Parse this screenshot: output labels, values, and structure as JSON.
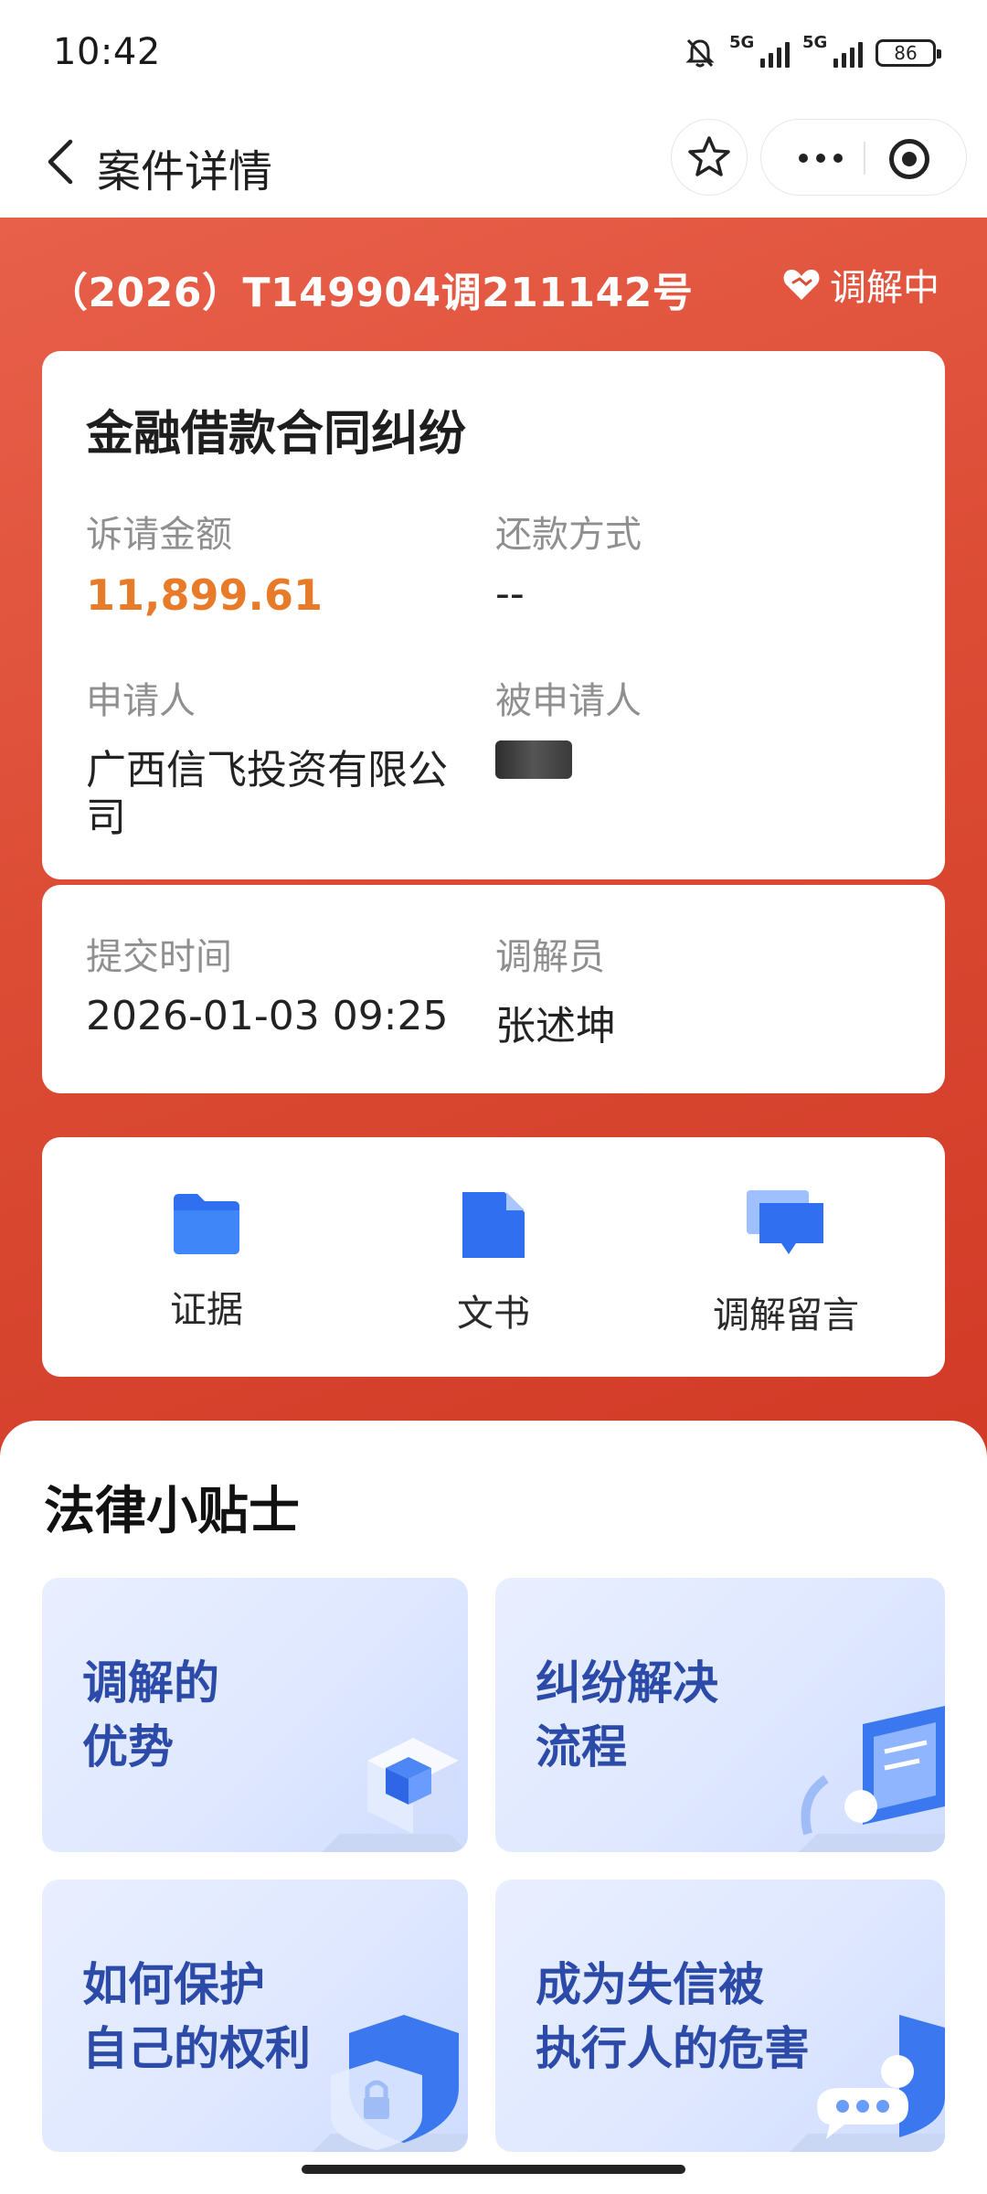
{
  "status_bar": {
    "time": "10:42",
    "network_1": "5G",
    "network_2": "5G",
    "battery": "86"
  },
  "nav": {
    "title": "案件详情",
    "back_icon": "chevron-left-icon",
    "favorite_icon": "star-icon",
    "more_icon": "more-dots-icon",
    "close_icon": "target-icon"
  },
  "case": {
    "number": "（2026）T149904调211142号",
    "status": "调解中",
    "status_icon": "heart-handshake-icon",
    "title": "金融借款合同纠纷",
    "claim_amount_label": "诉请金额",
    "claim_amount": "11,899.61",
    "repayment_label": "还款方式",
    "repayment": "--",
    "applicant_label": "申请人",
    "applicant_line1": "广西信飞投资有限公",
    "applicant_line2": "司",
    "respondent_label": "被申请人",
    "submit_time_label": "提交时间",
    "submit_time": "2026-01-03 09:25",
    "mediator_label": "调解员",
    "mediator": "张述坤"
  },
  "actions": [
    {
      "label": "证据",
      "icon": "folder-icon"
    },
    {
      "label": "文书",
      "icon": "document-icon"
    },
    {
      "label": "调解留言",
      "icon": "message-icon"
    }
  ],
  "tips": {
    "title": "法律小贴士",
    "items": [
      {
        "line1": "调解的",
        "line2": "优势"
      },
      {
        "line1": "纠纷解决",
        "line2": "流程"
      },
      {
        "line1": "如何保护",
        "line2": "自己的权利"
      },
      {
        "line1": "成为失信被",
        "line2": "执行人的危害"
      }
    ]
  },
  "colors": {
    "header_red": "#dc4c35",
    "amount_orange": "#e87b2a",
    "icon_blue": "#3478f6",
    "tip_text_blue": "#2c4aa8"
  }
}
